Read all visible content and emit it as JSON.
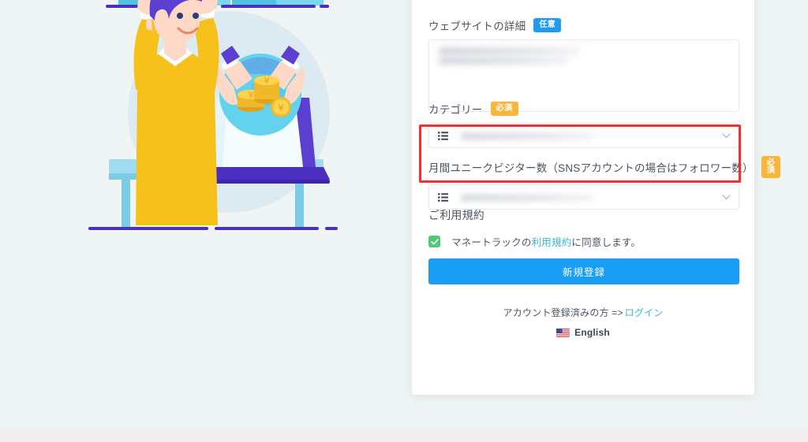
{
  "page": {
    "background_color": "#eff4f4",
    "card_background": "#ffffff"
  },
  "illustration": {
    "name": "celebrating-man-with-laptop-and-coins",
    "alt": "Man with raised arms celebrating beside a laptop showing hands holding yen coins"
  },
  "form": {
    "website_detail": {
      "label": "ウェブサイトの詳細",
      "badge": "任意",
      "badge_color": "#1f9bf0",
      "value": "",
      "placeholder": "",
      "redacted": true
    },
    "category": {
      "label": "カテゴリー",
      "badge": "必須",
      "badge_color": "#fcb53b",
      "icon": "list-icon",
      "value": "",
      "redacted": true,
      "highlighted": true
    },
    "monthly_visitors": {
      "label": "月間ユニークビジター数（SNSアカウントの場合はフォロワー数）",
      "badge": "必須",
      "badge_color": "#fcb53b",
      "icon": "list-icon",
      "value": "",
      "redacted": true
    },
    "terms": {
      "heading": "ご利用規約",
      "checked": true,
      "checkbox_color": "#4ecb71",
      "text_before": "マネートラックの",
      "link_text": "利用規約",
      "text_after": "に同意します。",
      "link_color": "#3bb6d6"
    },
    "submit": {
      "label": "新規登録",
      "color": "#1a9ef5"
    }
  },
  "footer": {
    "login_prompt": "アカウント登録済みの方 =>",
    "login_link": "ログイン",
    "language": {
      "icon": "us-flag-icon",
      "label": "English"
    }
  },
  "annotation": {
    "highlight_color": "#f92d2d",
    "target": "category-field"
  }
}
